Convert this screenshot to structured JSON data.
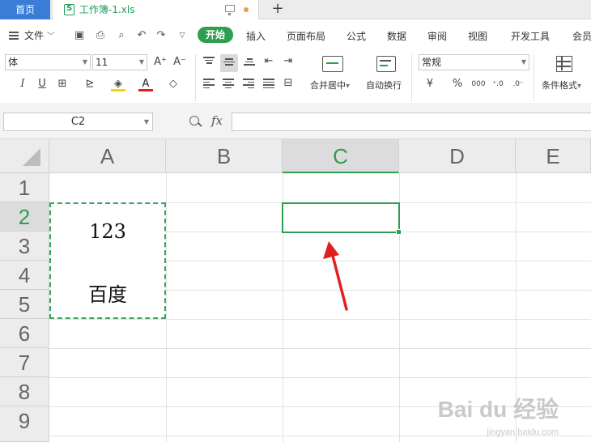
{
  "tabs": {
    "home": "首页",
    "document": "工作簿-1.xls",
    "new_tab": "+"
  },
  "menu": {
    "file": "文件",
    "items": [
      "开始",
      "插入",
      "页面布局",
      "公式",
      "数据",
      "审阅",
      "视图",
      "开发工具",
      "会员"
    ]
  },
  "ribbon": {
    "font_name": "体",
    "font_size": "11",
    "number_format": "常规",
    "merge_label": "合并居中",
    "wrap_label": "自动换行",
    "conditional_label": "条件格式",
    "currency_symbol": "¥",
    "percent_symbol": "%",
    "thousands_symbol": "000"
  },
  "formula_bar": {
    "name_box": "C2",
    "fx_label": "fx",
    "content": ""
  },
  "columns": [
    "A",
    "B",
    "C",
    "D",
    "E"
  ],
  "rows": [
    "1",
    "2",
    "3",
    "4",
    "5",
    "6",
    "7",
    "8",
    "9"
  ],
  "cells": {
    "A2": "123",
    "A4": "百度"
  },
  "watermark": {
    "brand": "Bai du 经验",
    "url": "jingyan.baidu.com"
  },
  "colors": {
    "accent": "#2e9e4f",
    "home_tab": "#3a7dd6",
    "arrow": "#e02020"
  }
}
